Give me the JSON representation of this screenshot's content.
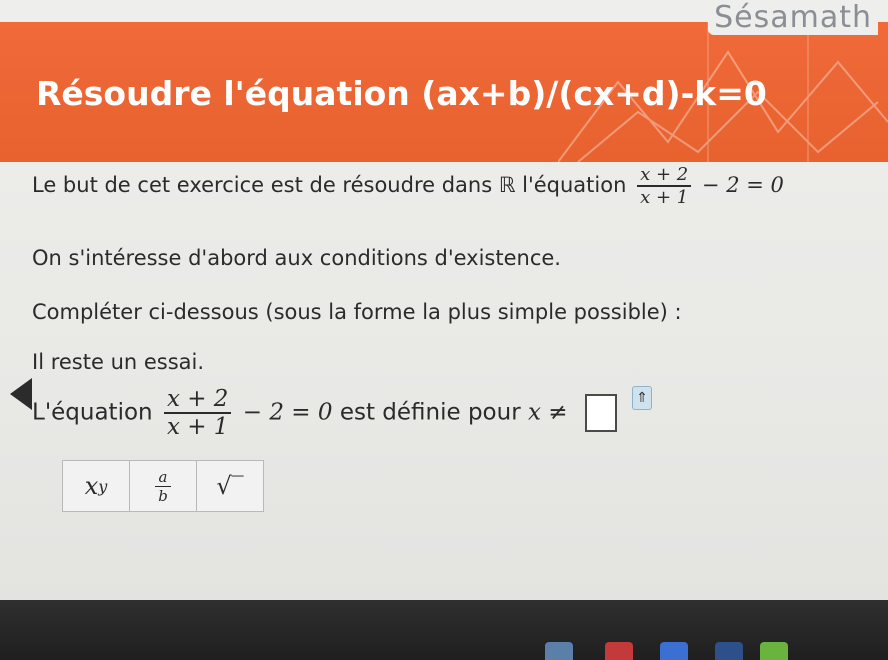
{
  "brand": "Sésamath",
  "title": "Résoudre l'équation (ax+b)/(cx+d)-k=0",
  "intro": {
    "text": "Le but de cet exercice est de résoudre dans ℝ l'équation",
    "fraction": {
      "numerator": "x + 2",
      "denominator": "x + 1"
    },
    "tail": "− 2 = 0"
  },
  "conditions_text": "On s'intéresse d'abord aux conditions d'existence.",
  "instruction_text": "Compléter ci-dessous (sous la forme la plus simple possible) :",
  "attempts_text": "Il reste un essai.",
  "question": {
    "prefix": "L'équation",
    "fraction": {
      "numerator": "x + 2",
      "denominator": "x + 1"
    },
    "tail": "− 2 = 0",
    "middle": "est définie pour",
    "condition": "x ≠",
    "answer_value": "",
    "toggle_icon": "⇑"
  },
  "keypad": {
    "power": {
      "base": "x",
      "exp": "y"
    },
    "fraction": {
      "numerator": "a",
      "denominator": "b"
    },
    "sqrt": "√‾"
  },
  "colors": {
    "header": "#e8622f",
    "background": "#eeeeec",
    "taskbar": "#222222"
  }
}
